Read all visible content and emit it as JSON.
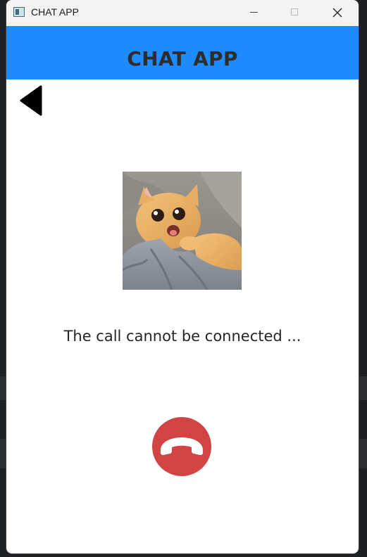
{
  "window": {
    "title": "CHAT APP"
  },
  "header": {
    "title": "CHAT APP"
  },
  "call": {
    "status": "The call cannot be connected ..."
  },
  "colors": {
    "header_bg": "#1e8bff",
    "end_call_bg": "#d24343",
    "title_text": "#2d2d2d"
  },
  "icons": {
    "back": "back-arrow-icon",
    "end_call": "phone-hangup-icon",
    "minimize": "minimize-icon",
    "maximize": "maximize-icon",
    "close": "close-icon"
  }
}
